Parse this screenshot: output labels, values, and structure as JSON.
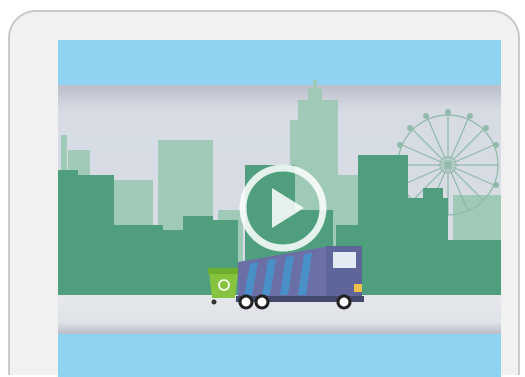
{
  "window": {
    "title": ""
  },
  "video": {
    "state": "paused",
    "scene": "city-skyline-with-garbage-truck",
    "play_control_icon": "play-icon"
  },
  "colors": {
    "sky": "#8fd3f1",
    "band": "#d3d8e1",
    "building_light": "#9ecab7",
    "building_dark": "#4f9f7e",
    "road": "#e7e9ee",
    "truck_body": "#6a6fa6",
    "truck_stripe": "#4a90c8",
    "bin": "#86c440",
    "play_overlay": "#ffffff"
  }
}
